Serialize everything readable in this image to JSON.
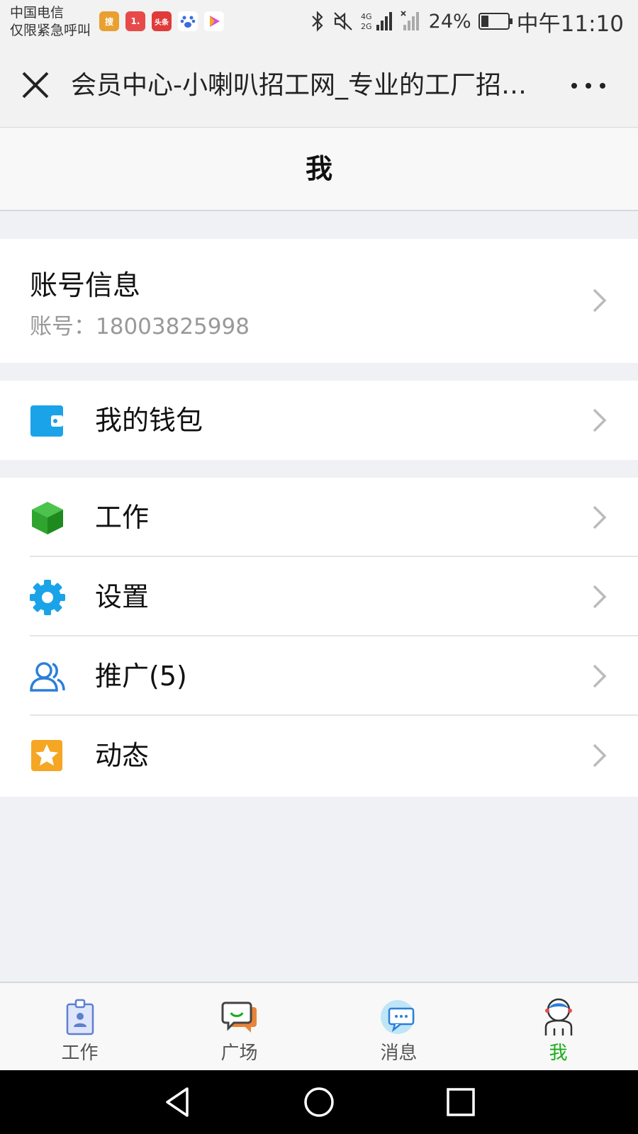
{
  "status_bar": {
    "carrier_line1": "中国电信",
    "carrier_line2": "仅限紧急呼叫",
    "network_label": "4G",
    "battery_percent": "24%",
    "time": "中午11:10",
    "notification_icons": [
      "sougou-icon",
      "app-1-icon",
      "toutiao-icon",
      "baidu-icon",
      "video-icon"
    ]
  },
  "browser": {
    "page_title": "会员中心-小喇叭招工网_专业的工厂招…"
  },
  "page": {
    "title": "我"
  },
  "account": {
    "title": "账号信息",
    "account_number": "账号：18003825998"
  },
  "menu": {
    "wallet": "我的钱包",
    "work": "工作",
    "settings": "设置",
    "promotion": "推广(5)",
    "activity": "动态"
  },
  "tabs": [
    {
      "label": "工作"
    },
    {
      "label": "广场"
    },
    {
      "label": "消息"
    },
    {
      "label": "我"
    }
  ],
  "colors": {
    "active_tab": "#1aad19",
    "wallet_icon": "#1aa3e8",
    "work_icon": "#2fa52f",
    "settings_icon": "#1aa3e8",
    "promotion_icon": "#2b7fd9",
    "activity_icon": "#f5a623",
    "background": "#eff1f4"
  }
}
